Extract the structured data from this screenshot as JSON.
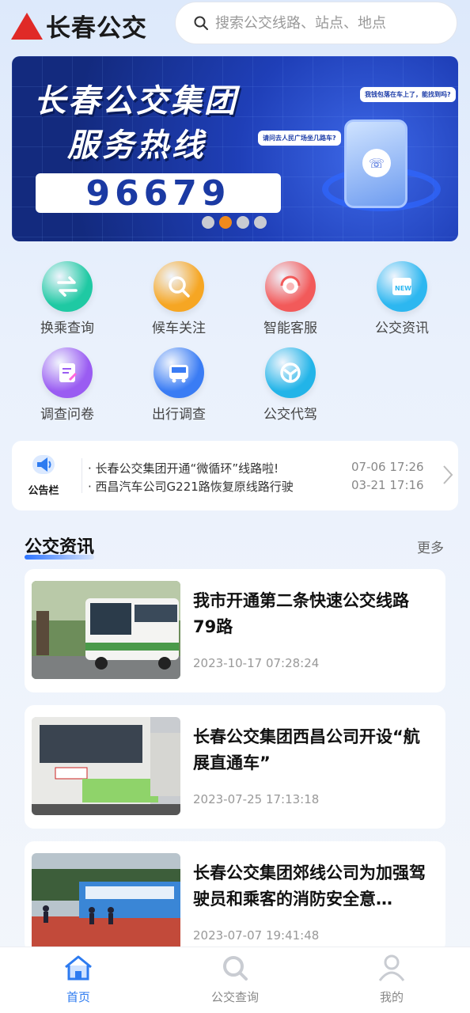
{
  "header": {
    "app_title": "长春公交",
    "search_placeholder": "搜索公交线路、站点、地点"
  },
  "banner": {
    "line1": "长春公交集团",
    "line2": "服务热线",
    "hotline": "96679",
    "bubble1": "我钱包落在车上了，能找到吗?",
    "bubble2": "请问去人民广场坐几路车?",
    "active_slide": 2,
    "slide_count": 4
  },
  "services": [
    {
      "label": "换乘查询",
      "icon": "transfer-icon",
      "color": "#1fc9a3"
    },
    {
      "label": "候车关注",
      "icon": "search-icon",
      "color": "#f6a623"
    },
    {
      "label": "智能客服",
      "icon": "customer-service-icon",
      "color": "#f25a5a"
    },
    {
      "label": "公交资讯",
      "icon": "news-icon",
      "color": "#2db7f0"
    },
    {
      "label": "调查问卷",
      "icon": "questionnaire-icon",
      "color": "#9a5cf2"
    },
    {
      "label": "出行调查",
      "icon": "bus-icon",
      "color": "#3a7cf4"
    },
    {
      "label": "公交代驾",
      "icon": "steering-wheel-icon",
      "color": "#22b4e8"
    }
  ],
  "notice": {
    "label": "公告栏",
    "items": [
      {
        "text": "长春公交集团开通“微循环”线路啦!",
        "time": "07-06 17:26"
      },
      {
        "text": "西昌汽车公司G221路恢复原线路行驶",
        "time": "03-21 17:16"
      }
    ]
  },
  "news_section": {
    "title": "公交资讯",
    "more": "更多",
    "items": [
      {
        "title": "我市开通第二条快速公交线路79路",
        "date": "2023-10-17 07:28:24"
      },
      {
        "title": "长春公交集团西昌公司开设“航展直通车”",
        "date": "2023-07-25 17:13:18"
      },
      {
        "title": "长春公交集团郊线公司为加强驾驶员和乘客的消防安全意…",
        "date": "2023-07-07 19:41:48"
      }
    ]
  },
  "tabbar": {
    "tabs": [
      {
        "label": "首页",
        "icon": "home-icon",
        "active": true
      },
      {
        "label": "公交查询",
        "icon": "search-icon",
        "active": false
      },
      {
        "label": "我的",
        "icon": "user-icon",
        "active": false
      }
    ]
  }
}
